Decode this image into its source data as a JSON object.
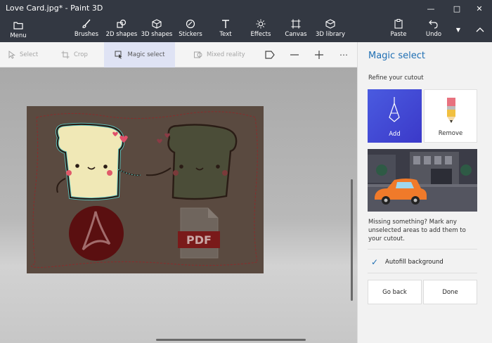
{
  "window": {
    "title": "Love Card.jpg* - Paint 3D"
  },
  "toolbar": {
    "menu": "Menu",
    "tools": [
      "Brushes",
      "2D shapes",
      "3D shapes",
      "Stickers",
      "Text",
      "Effects",
      "Canvas",
      "3D library"
    ],
    "paste": "Paste",
    "undo": "Undo"
  },
  "subtoolbar": {
    "select": "Select",
    "crop": "Crop",
    "magic_select": "Magic select",
    "mixed_reality": "Mixed reality"
  },
  "canvas": {
    "pdf_label": "PDF"
  },
  "panel": {
    "title": "Magic select",
    "refine": "Refine your cutout",
    "add": "Add",
    "remove": "Remove",
    "hint": "Missing something? Mark any unselected areas to add them to your cutout.",
    "autofill": "Autofill background",
    "go_back": "Go back",
    "done": "Done"
  },
  "colors": {
    "accent": "#1f6fb3",
    "topbar": "#333842",
    "add_tile": "#4050d8"
  }
}
